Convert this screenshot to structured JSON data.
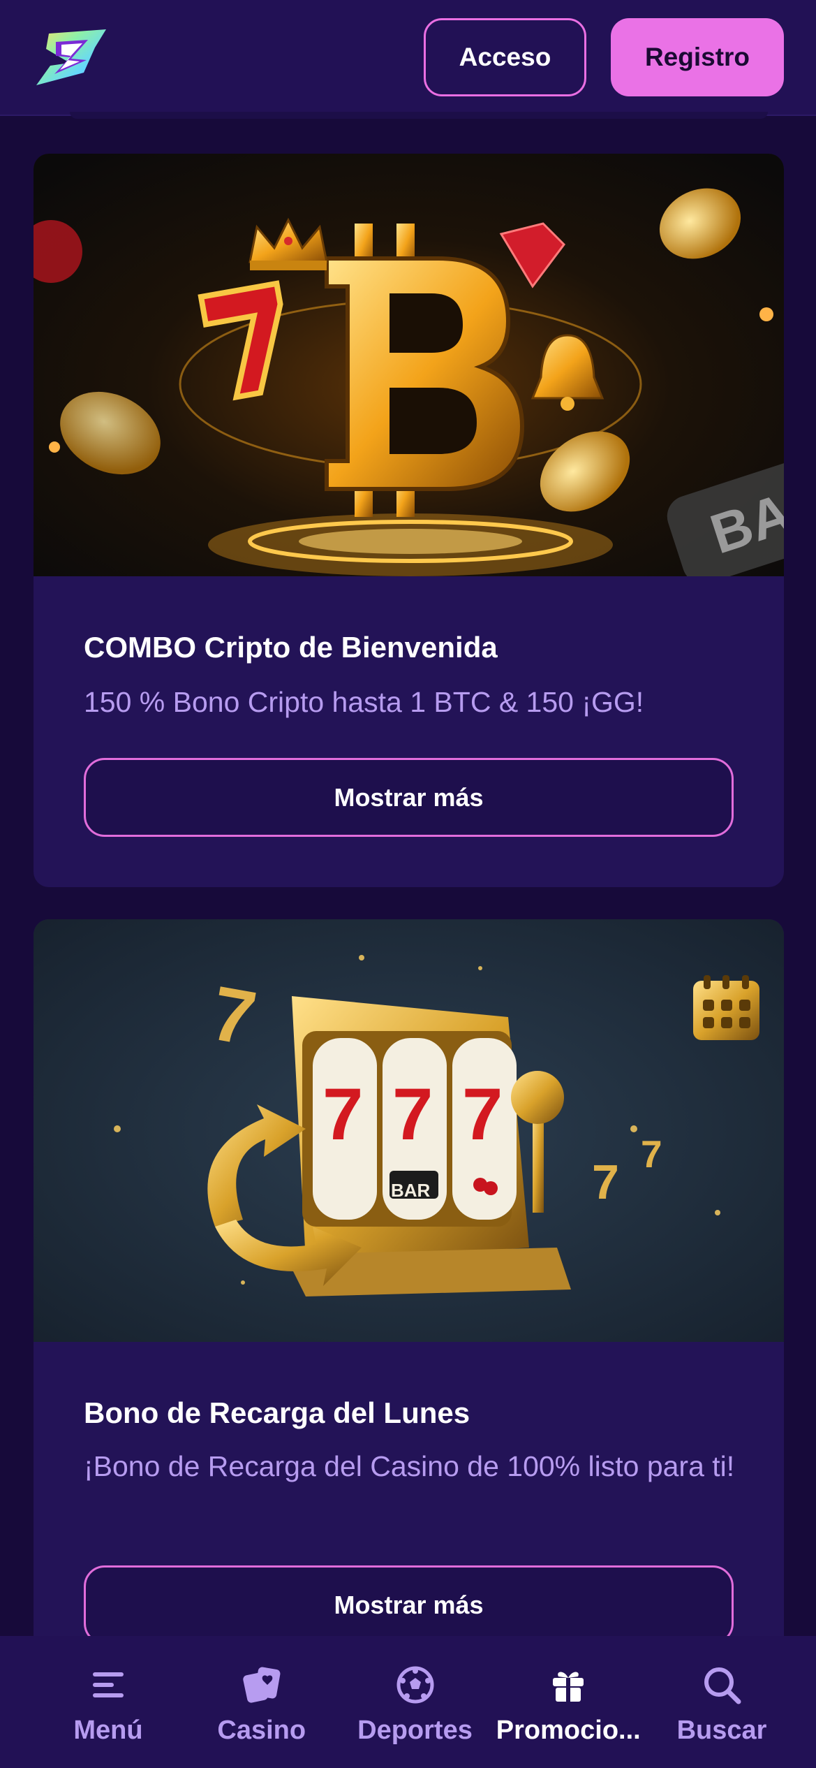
{
  "header": {
    "login_label": "Acceso",
    "register_label": "Registro"
  },
  "promos": [
    {
      "title": "COMBO Cripto de Bienvenida",
      "description": "150 % Bono Cripto hasta 1 BTC & 150 ¡GG!",
      "button_label": "Mostrar más",
      "image_text": "BAR"
    },
    {
      "title": "Bono de Recarga del Lunes",
      "description": "¡Bono de Recarga del Casino de 100% listo para ti!",
      "button_label": "Mostrar más",
      "image_text": "BAR"
    }
  ],
  "bottom_nav": [
    {
      "label": "Menú",
      "icon": "menu-icon"
    },
    {
      "label": "Casino",
      "icon": "casino-cards-icon"
    },
    {
      "label": "Deportes",
      "icon": "soccer-ball-icon"
    },
    {
      "label": "Promocio...",
      "icon": "gift-icon",
      "active": true
    },
    {
      "label": "Buscar",
      "icon": "search-icon"
    }
  ],
  "colors": {
    "background": "#170a3a",
    "surface": "#231357",
    "accent": "#ea72e6",
    "muted_text": "#b79cf0"
  }
}
